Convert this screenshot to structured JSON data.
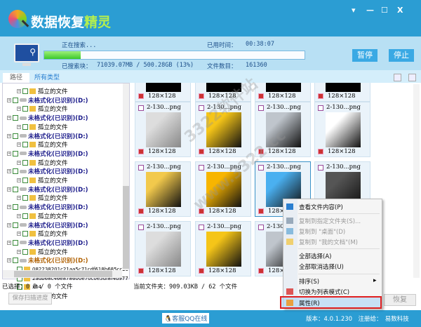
{
  "app": {
    "title_main": "数据恢复",
    "title_accent": "精灵",
    "window_controls": [
      "▾",
      "—",
      "☐",
      "X"
    ]
  },
  "search": {
    "status": "正在搜索...",
    "elapsed_label": "已用时间：",
    "elapsed": "00:38:07",
    "searched_label": "已搜索块：",
    "searched": "71039.07MB / 500.28GB (13%)",
    "count_label": "文件数目：",
    "count": "161360",
    "progress_percent": 14,
    "pause": "暂停",
    "stop": "停止"
  },
  "tabs": [
    "路径",
    "所有类型"
  ],
  "tree": {
    "orphan": "孤立的文件",
    "drive": "未格式化(已识别)(D:)",
    "subfolders": [
      "082238201c21aa5c71cdf618b685cc25",
      "2adb68c46e878600e70c0e5df8f4d977",
      "x64"
    ]
  },
  "grid": {
    "name": "2-130...png",
    "dim": "128×128"
  },
  "status": {
    "selected": "已选择：0 B / 0 个文件",
    "current": "当前文件夹：909.03KB / 62 个文件"
  },
  "buttons": {
    "save": "保存扫描进度",
    "recover": "恢复"
  },
  "footer": {
    "qq": "客服QQ在线",
    "version": "版本：4.0.1.230　注册给：　易数科技"
  },
  "menu": {
    "items": [
      "查看文件内容(P)",
      "复制到指定文件夹(S)...",
      "复制到 \"桌面\"(D)",
      "复制到 \"我的文档\"(M)",
      "全部选择(A)",
      "全部取消选择(U)",
      "排序(S)",
      "切换为列表模式(C)",
      "属性(R)"
    ]
  },
  "watermark": "3322软件站 www.3322.cc",
  "colors": {
    "brand": "#2b9dd3",
    "progress": "#3cc82a",
    "highlight": "#e02020"
  }
}
